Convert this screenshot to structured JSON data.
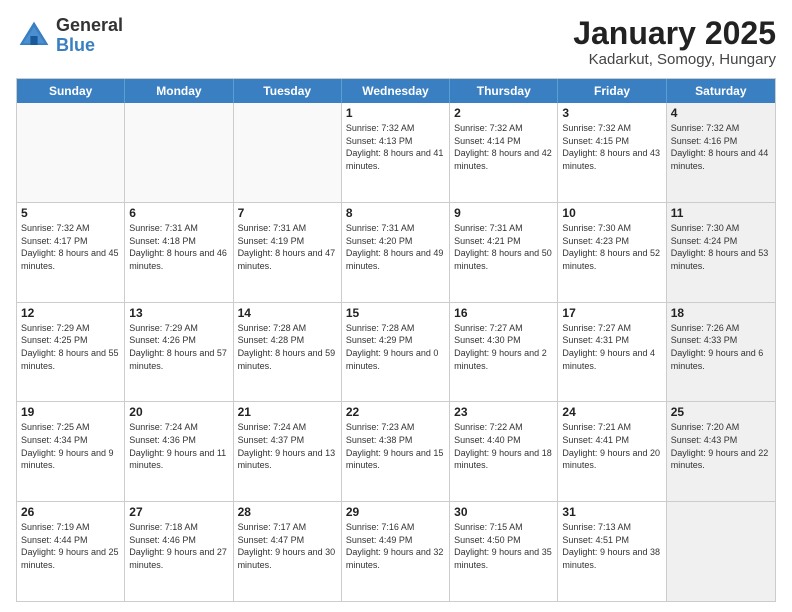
{
  "header": {
    "logo_line1": "General",
    "logo_line2": "Blue",
    "title": "January 2025",
    "subtitle": "Kadarkut, Somogy, Hungary"
  },
  "calendar": {
    "days_of_week": [
      "Sunday",
      "Monday",
      "Tuesday",
      "Wednesday",
      "Thursday",
      "Friday",
      "Saturday"
    ],
    "rows": [
      [
        {
          "day": "",
          "info": "",
          "shaded": false,
          "empty": true
        },
        {
          "day": "",
          "info": "",
          "shaded": false,
          "empty": true
        },
        {
          "day": "",
          "info": "",
          "shaded": false,
          "empty": true
        },
        {
          "day": "1",
          "info": "Sunrise: 7:32 AM\nSunset: 4:13 PM\nDaylight: 8 hours and 41 minutes.",
          "shaded": false,
          "empty": false
        },
        {
          "day": "2",
          "info": "Sunrise: 7:32 AM\nSunset: 4:14 PM\nDaylight: 8 hours and 42 minutes.",
          "shaded": false,
          "empty": false
        },
        {
          "day": "3",
          "info": "Sunrise: 7:32 AM\nSunset: 4:15 PM\nDaylight: 8 hours and 43 minutes.",
          "shaded": false,
          "empty": false
        },
        {
          "day": "4",
          "info": "Sunrise: 7:32 AM\nSunset: 4:16 PM\nDaylight: 8 hours and 44 minutes.",
          "shaded": true,
          "empty": false
        }
      ],
      [
        {
          "day": "5",
          "info": "Sunrise: 7:32 AM\nSunset: 4:17 PM\nDaylight: 8 hours and 45 minutes.",
          "shaded": false,
          "empty": false
        },
        {
          "day": "6",
          "info": "Sunrise: 7:31 AM\nSunset: 4:18 PM\nDaylight: 8 hours and 46 minutes.",
          "shaded": false,
          "empty": false
        },
        {
          "day": "7",
          "info": "Sunrise: 7:31 AM\nSunset: 4:19 PM\nDaylight: 8 hours and 47 minutes.",
          "shaded": false,
          "empty": false
        },
        {
          "day": "8",
          "info": "Sunrise: 7:31 AM\nSunset: 4:20 PM\nDaylight: 8 hours and 49 minutes.",
          "shaded": false,
          "empty": false
        },
        {
          "day": "9",
          "info": "Sunrise: 7:31 AM\nSunset: 4:21 PM\nDaylight: 8 hours and 50 minutes.",
          "shaded": false,
          "empty": false
        },
        {
          "day": "10",
          "info": "Sunrise: 7:30 AM\nSunset: 4:23 PM\nDaylight: 8 hours and 52 minutes.",
          "shaded": false,
          "empty": false
        },
        {
          "day": "11",
          "info": "Sunrise: 7:30 AM\nSunset: 4:24 PM\nDaylight: 8 hours and 53 minutes.",
          "shaded": true,
          "empty": false
        }
      ],
      [
        {
          "day": "12",
          "info": "Sunrise: 7:29 AM\nSunset: 4:25 PM\nDaylight: 8 hours and 55 minutes.",
          "shaded": false,
          "empty": false
        },
        {
          "day": "13",
          "info": "Sunrise: 7:29 AM\nSunset: 4:26 PM\nDaylight: 8 hours and 57 minutes.",
          "shaded": false,
          "empty": false
        },
        {
          "day": "14",
          "info": "Sunrise: 7:28 AM\nSunset: 4:28 PM\nDaylight: 8 hours and 59 minutes.",
          "shaded": false,
          "empty": false
        },
        {
          "day": "15",
          "info": "Sunrise: 7:28 AM\nSunset: 4:29 PM\nDaylight: 9 hours and 0 minutes.",
          "shaded": false,
          "empty": false
        },
        {
          "day": "16",
          "info": "Sunrise: 7:27 AM\nSunset: 4:30 PM\nDaylight: 9 hours and 2 minutes.",
          "shaded": false,
          "empty": false
        },
        {
          "day": "17",
          "info": "Sunrise: 7:27 AM\nSunset: 4:31 PM\nDaylight: 9 hours and 4 minutes.",
          "shaded": false,
          "empty": false
        },
        {
          "day": "18",
          "info": "Sunrise: 7:26 AM\nSunset: 4:33 PM\nDaylight: 9 hours and 6 minutes.",
          "shaded": true,
          "empty": false
        }
      ],
      [
        {
          "day": "19",
          "info": "Sunrise: 7:25 AM\nSunset: 4:34 PM\nDaylight: 9 hours and 9 minutes.",
          "shaded": false,
          "empty": false
        },
        {
          "day": "20",
          "info": "Sunrise: 7:24 AM\nSunset: 4:36 PM\nDaylight: 9 hours and 11 minutes.",
          "shaded": false,
          "empty": false
        },
        {
          "day": "21",
          "info": "Sunrise: 7:24 AM\nSunset: 4:37 PM\nDaylight: 9 hours and 13 minutes.",
          "shaded": false,
          "empty": false
        },
        {
          "day": "22",
          "info": "Sunrise: 7:23 AM\nSunset: 4:38 PM\nDaylight: 9 hours and 15 minutes.",
          "shaded": false,
          "empty": false
        },
        {
          "day": "23",
          "info": "Sunrise: 7:22 AM\nSunset: 4:40 PM\nDaylight: 9 hours and 18 minutes.",
          "shaded": false,
          "empty": false
        },
        {
          "day": "24",
          "info": "Sunrise: 7:21 AM\nSunset: 4:41 PM\nDaylight: 9 hours and 20 minutes.",
          "shaded": false,
          "empty": false
        },
        {
          "day": "25",
          "info": "Sunrise: 7:20 AM\nSunset: 4:43 PM\nDaylight: 9 hours and 22 minutes.",
          "shaded": true,
          "empty": false
        }
      ],
      [
        {
          "day": "26",
          "info": "Sunrise: 7:19 AM\nSunset: 4:44 PM\nDaylight: 9 hours and 25 minutes.",
          "shaded": false,
          "empty": false
        },
        {
          "day": "27",
          "info": "Sunrise: 7:18 AM\nSunset: 4:46 PM\nDaylight: 9 hours and 27 minutes.",
          "shaded": false,
          "empty": false
        },
        {
          "day": "28",
          "info": "Sunrise: 7:17 AM\nSunset: 4:47 PM\nDaylight: 9 hours and 30 minutes.",
          "shaded": false,
          "empty": false
        },
        {
          "day": "29",
          "info": "Sunrise: 7:16 AM\nSunset: 4:49 PM\nDaylight: 9 hours and 32 minutes.",
          "shaded": false,
          "empty": false
        },
        {
          "day": "30",
          "info": "Sunrise: 7:15 AM\nSunset: 4:50 PM\nDaylight: 9 hours and 35 minutes.",
          "shaded": false,
          "empty": false
        },
        {
          "day": "31",
          "info": "Sunrise: 7:13 AM\nSunset: 4:51 PM\nDaylight: 9 hours and 38 minutes.",
          "shaded": false,
          "empty": false
        },
        {
          "day": "",
          "info": "",
          "shaded": true,
          "empty": true
        }
      ]
    ]
  }
}
